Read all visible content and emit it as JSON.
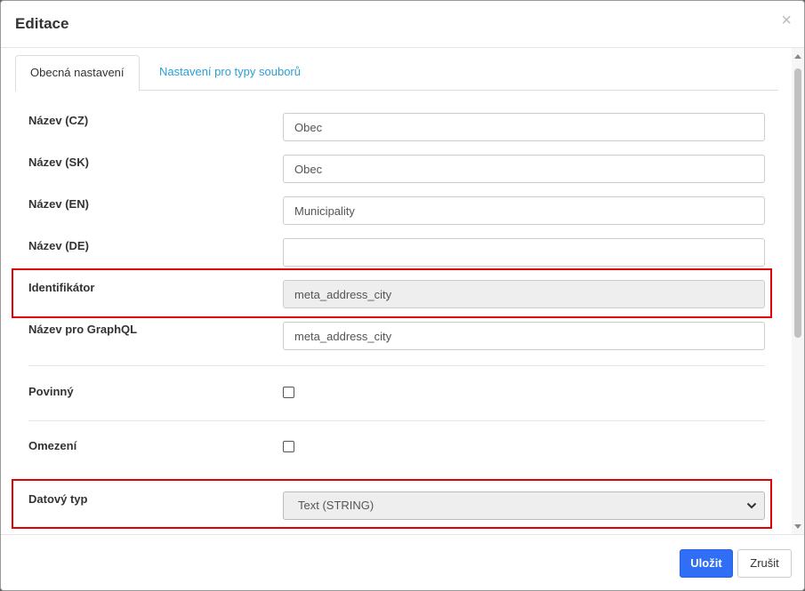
{
  "dialog": {
    "title": "Editace",
    "close_glyph": "×"
  },
  "tabs": [
    {
      "label": "Obecná nastavení",
      "active": true
    },
    {
      "label": "Nastavení pro typy souborů",
      "active": false
    }
  ],
  "form": {
    "name_cz": {
      "label": "Název (CZ)",
      "value": "Obec"
    },
    "name_sk": {
      "label": "Název (SK)",
      "value": "Obec"
    },
    "name_en": {
      "label": "Název (EN)",
      "value": "Municipality"
    },
    "name_de": {
      "label": "Název (DE)",
      "value": ""
    },
    "identifier": {
      "label": "Identifikátor",
      "value": "meta_address_city",
      "readonly": true
    },
    "graphql_name": {
      "label": "Název pro GraphQL",
      "value": "meta_address_city"
    },
    "required": {
      "label": "Povinný",
      "checked": false
    },
    "restriction": {
      "label": "Omezení",
      "checked": false
    },
    "data_type": {
      "label": "Datový typ",
      "selected": "Text (STRING)"
    }
  },
  "footer": {
    "save_label": "Uložit",
    "cancel_label": "Zrušit"
  },
  "colors": {
    "primary": "#2f6ef5",
    "tab_link": "#2a9fd6",
    "highlight": "#e00000"
  },
  "icons": {
    "close": "close-icon",
    "select_chevron": "chevron-down-icon",
    "scroll_up": "scroll-up-arrow-icon",
    "scroll_down": "scroll-down-arrow-icon"
  }
}
